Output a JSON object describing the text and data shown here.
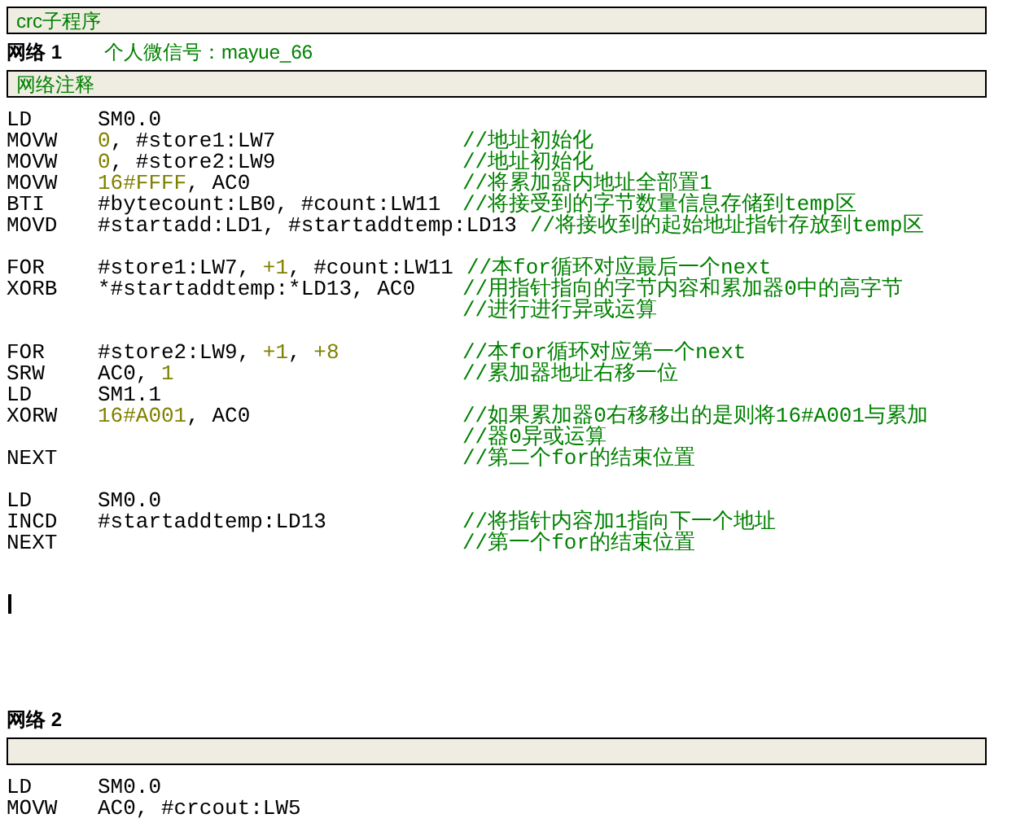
{
  "title": "crc子程序",
  "networks": [
    {
      "label": "网络 1",
      "note": "个人微信号：mayue_66",
      "comment": "网络注释",
      "groups": [
        [
          {
            "op": "LD",
            "operand": [
              {
                "kind": "plain",
                "text": "SM0.0"
              }
            ]
          },
          {
            "op": "MOVW",
            "operand": [
              {
                "kind": "const",
                "text": "0"
              },
              {
                "kind": "plain",
                "text": ", #store1:LW7"
              }
            ],
            "remark": "//地址初始化"
          },
          {
            "op": "MOVW",
            "operand": [
              {
                "kind": "const",
                "text": "0"
              },
              {
                "kind": "plain",
                "text": ", #store2:LW9"
              }
            ],
            "remark": "//地址初始化"
          },
          {
            "op": "MOVW",
            "operand": [
              {
                "kind": "const",
                "text": "16#FFFF"
              },
              {
                "kind": "plain",
                "text": ", AC0"
              }
            ],
            "remark": "//将累加器内地址全部置1"
          },
          {
            "op": "BTI",
            "operand": [
              {
                "kind": "plain",
                "text": "#bytecount:LB0, #count:LW11"
              }
            ],
            "remark": "//将接受到的字节数量信息存储到temp区"
          },
          {
            "op": "MOVD",
            "operand": [
              {
                "kind": "plain",
                "text": "#startadd:LD1, #startaddtemp:LD13"
              }
            ],
            "remark": "//将接收到的起始地址指针存放到temp区"
          }
        ],
        [
          {
            "op": "FOR",
            "operand": [
              {
                "kind": "plain",
                "text": "#store1:LW7, "
              },
              {
                "kind": "const",
                "text": "+1"
              },
              {
                "kind": "plain",
                "text": ", #count:LW11"
              }
            ],
            "remark": "//本for循环对应最后一个next"
          },
          {
            "op": "XORB",
            "operand": [
              {
                "kind": "plain",
                "text": "*#startaddtemp:*LD13, AC0"
              }
            ],
            "remark": "//用指针指向的字节内容和累加器0中的高字节"
          },
          {
            "remark": "//进行进行异或运算"
          }
        ],
        [
          {
            "op": "FOR",
            "operand": [
              {
                "kind": "plain",
                "text": "#store2:LW9, "
              },
              {
                "kind": "const",
                "text": "+1"
              },
              {
                "kind": "plain",
                "text": ", "
              },
              {
                "kind": "const",
                "text": "+8"
              }
            ],
            "remark": "//本for循环对应第一个next"
          },
          {
            "op": "SRW",
            "operand": [
              {
                "kind": "plain",
                "text": "AC0, "
              },
              {
                "kind": "const",
                "text": "1"
              }
            ],
            "remark": "//累加器地址右移一位"
          },
          {
            "op": "LD",
            "operand": [
              {
                "kind": "plain",
                "text": "SM1.1"
              }
            ]
          },
          {
            "op": "XORW",
            "operand": [
              {
                "kind": "const",
                "text": "16#A001"
              },
              {
                "kind": "plain",
                "text": ", AC0"
              }
            ],
            "remark": "//如果累加器0右移移出的是则将16#A001与累加"
          },
          {
            "remark": "//器0异或运算"
          },
          {
            "op": "NEXT",
            "remark": "//第二个for的结束位置"
          }
        ],
        [
          {
            "op": "LD",
            "operand": [
              {
                "kind": "plain",
                "text": "SM0.0"
              }
            ]
          },
          {
            "op": "INCD",
            "operand": [
              {
                "kind": "plain",
                "text": "#startaddtemp:LD13"
              }
            ],
            "remark": "//将指针内容加1指向下一个地址"
          },
          {
            "op": "NEXT",
            "remark": "//第一个for的结束位置"
          }
        ]
      ]
    },
    {
      "label": "网络 2",
      "groups": [
        [
          {
            "op": "LD",
            "operand": [
              {
                "kind": "plain",
                "text": "SM0.0"
              }
            ]
          },
          {
            "op": "MOVW",
            "operand": [
              {
                "kind": "plain",
                "text": "AC0, #crcout:LW5"
              }
            ]
          }
        ]
      ]
    }
  ]
}
